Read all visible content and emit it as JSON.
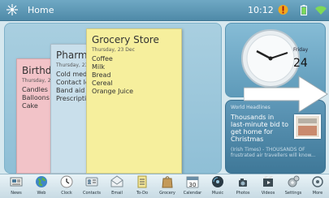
{
  "status_bar": {
    "title": "Home",
    "time": "10:12"
  },
  "notes": {
    "birthday": {
      "title": "Birthday",
      "date": "Thursday, 23 Dec",
      "items": [
        "Candles",
        "Balloons",
        "Cake"
      ]
    },
    "pharmacy": {
      "title": "Pharmacy",
      "date": "Thursday, 23 Dec",
      "items": [
        "Cold medicine",
        "Contact lens",
        "Band aid",
        "Prescription"
      ]
    },
    "grocery": {
      "title": "Grocery Store",
      "date": "Thursday, 23 Dec",
      "items": [
        "Coffee",
        "Milk",
        "Bread",
        "Cereal",
        "Orange Juice"
      ]
    }
  },
  "clock_widget": {
    "day": "Friday",
    "date": "24"
  },
  "news_widget": {
    "header": "World Headlines",
    "headline": "Thousands in last-minute bid to get home for Christmas",
    "snippet": "(Irish Times) - THOUSANDS OF frustrated air travellers will know..."
  },
  "dock": [
    {
      "label": "News",
      "icon": "news-icon"
    },
    {
      "label": "Web",
      "icon": "globe-icon"
    },
    {
      "label": "Clock",
      "icon": "clock-icon"
    },
    {
      "label": "Contacts",
      "icon": "contacts-icon"
    },
    {
      "label": "Email",
      "icon": "email-icon"
    },
    {
      "label": "To-Do",
      "icon": "todo-icon"
    },
    {
      "label": "Grocery",
      "icon": "grocery-bag-icon"
    },
    {
      "label": "Calendar",
      "icon": "calendar-icon",
      "badge": "30"
    },
    {
      "label": "Music",
      "icon": "music-icon"
    },
    {
      "label": "Photos",
      "icon": "photos-icon"
    },
    {
      "label": "Videos",
      "icon": "videos-icon"
    },
    {
      "label": "Settings",
      "icon": "settings-icon"
    },
    {
      "label": "More",
      "icon": "more-icon"
    }
  ],
  "colors": {
    "status_bar": "#5b95b3",
    "grocery_note": "#f6ef9d",
    "birthday_note": "#f2c3c8",
    "pharmacy_note": "#c9dfeb"
  }
}
